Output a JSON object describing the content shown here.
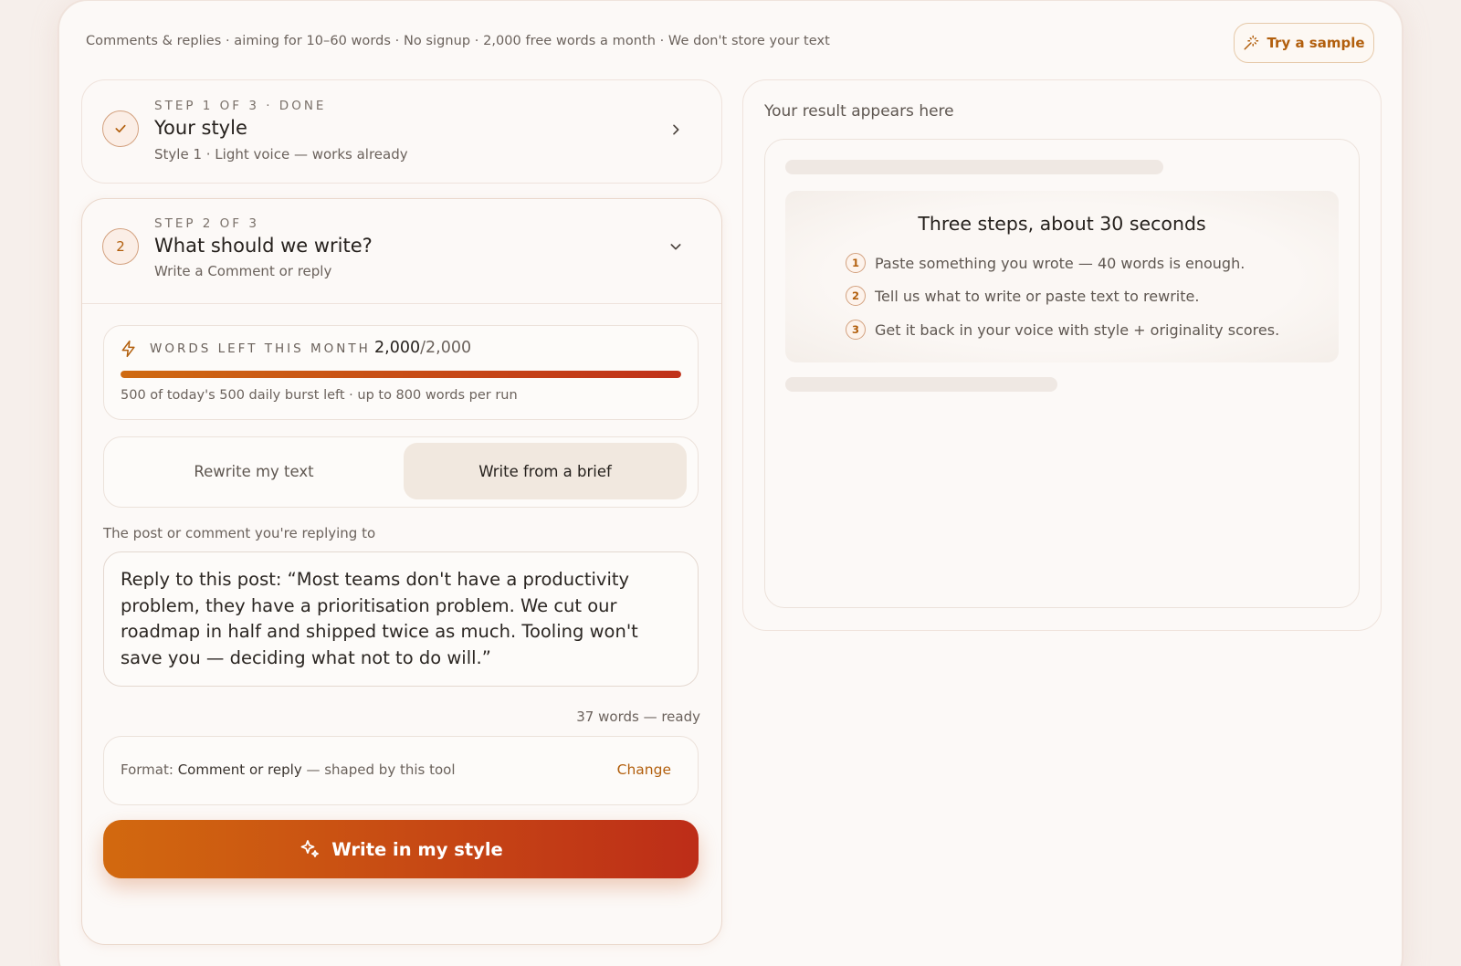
{
  "header": {
    "tagline": "Comments & replies · aiming for 10–60 words · No signup · 2,000 free words a month · We don't store your text",
    "sample_button": "Try a sample",
    "sample_icon": "magic-wand-icon"
  },
  "step1": {
    "overline": "STEP 1 OF 3 · DONE",
    "title": "Your style",
    "subtitle": "Style 1 · Light voice — works already",
    "status_icon": "check-icon"
  },
  "step2": {
    "number": "2",
    "overline": "STEP 2 OF 3",
    "title": "What should we write?",
    "subtitle": "Write a Comment or reply",
    "quota": {
      "label": "WORDS LEFT THIS MONTH",
      "remaining": "2,000",
      "total": "/2,000",
      "fill_fraction": 1.0,
      "note": "500 of today's 500 daily burst left · up to 800 words per run"
    },
    "modes": [
      "Rewrite my text",
      "Write from a brief"
    ],
    "selected_mode": "Write from a brief",
    "field_label": "The post or comment you're replying to",
    "field_value": "Reply to this post: “Most teams don't have a productivity problem, they have a prioritisation problem. We cut our roadmap in half and shipped twice as much. Tooling won't save you — deciding what not to do will.”",
    "word_count": "37 words — ready",
    "format": {
      "prefix": "Format: ",
      "value": "Comment or reply",
      "suffix": " — shaped by this tool",
      "change": "Change"
    },
    "cta": "Write in my style"
  },
  "result": {
    "title": "Your result appears here",
    "how_title": "Three steps, about 30 seconds",
    "how_steps": [
      {
        "n": "1",
        "text": "Paste something you wrote — 40 words is enough."
      },
      {
        "n": "2",
        "text": "Tell us what to write or paste text to rewrite."
      },
      {
        "n": "3",
        "text": "Get it back in your voice with style + originality scores."
      }
    ]
  },
  "colors": {
    "accent": "#b25f0d",
    "gradient_start": "#d2690f",
    "gradient_end": "#bd2d18"
  }
}
